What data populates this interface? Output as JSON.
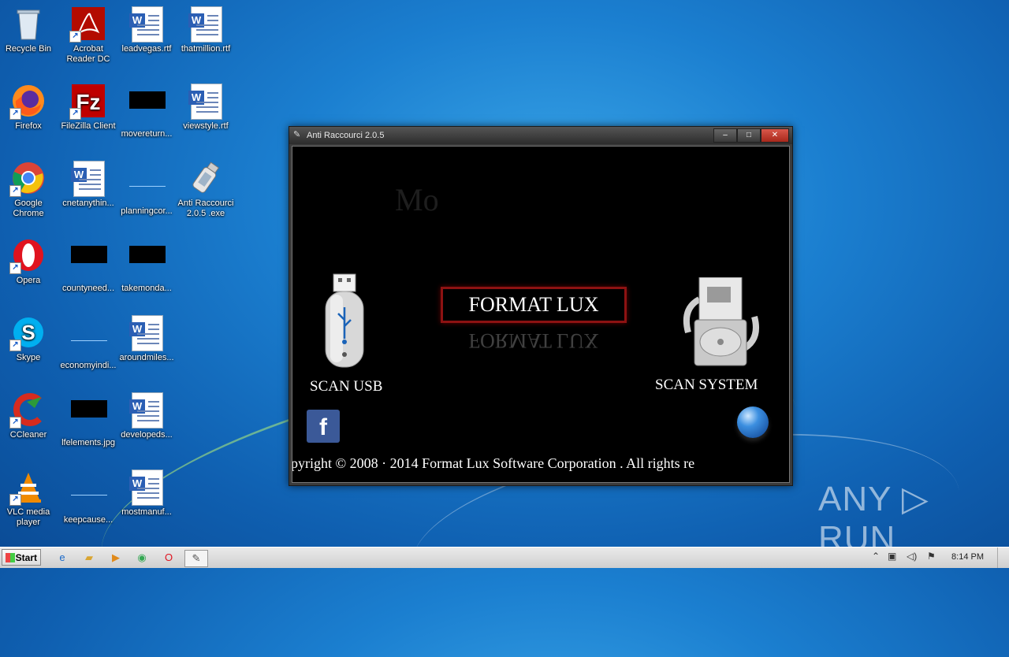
{
  "desktop": {
    "icons": [
      {
        "label": "Recycle Bin"
      },
      {
        "label": "Acrobat Reader DC"
      },
      {
        "label": "leadvegas.rtf"
      },
      {
        "label": "thatmillion.rtf"
      },
      {
        "label": "Firefox"
      },
      {
        "label": "FileZilla Client"
      },
      {
        "label": "movereturn..."
      },
      {
        "label": "viewstyle.rtf"
      },
      {
        "label": "Google Chrome"
      },
      {
        "label": "cnetanythin..."
      },
      {
        "label": "planningcor..."
      },
      {
        "label": "Anti Raccourci 2.0.5 .exe"
      },
      {
        "label": "Opera"
      },
      {
        "label": "countyneed..."
      },
      {
        "label": "takemonda..."
      },
      {
        "label": "Skype"
      },
      {
        "label": "economyindi..."
      },
      {
        "label": "aroundmiles..."
      },
      {
        "label": "CCleaner"
      },
      {
        "label": "lfelements.jpg"
      },
      {
        "label": "developeds..."
      },
      {
        "label": "VLC media player"
      },
      {
        "label": "keepcause..."
      },
      {
        "label": "mostmanuf..."
      }
    ]
  },
  "window": {
    "title": "Anti Raccourci 2.0.5",
    "minimize": "–",
    "maximize": "□",
    "close": "✕",
    "faded_text": "Mo",
    "logo": "FORMAT LUX",
    "scan_usb": "SCAN USB",
    "scan_system": "SCAN SYSTEM",
    "facebook": "f",
    "copyright": "pyright © 2008 · 2014  Format Lux  Software Corporation . All rights re"
  },
  "watermark": "ANY ▷ RUN",
  "taskbar": {
    "start": "Start",
    "clock": "8:14 PM"
  },
  "colors": {
    "logo_border": "#8d1212",
    "close_button": "#c0392b",
    "facebook": "#3b5998"
  }
}
